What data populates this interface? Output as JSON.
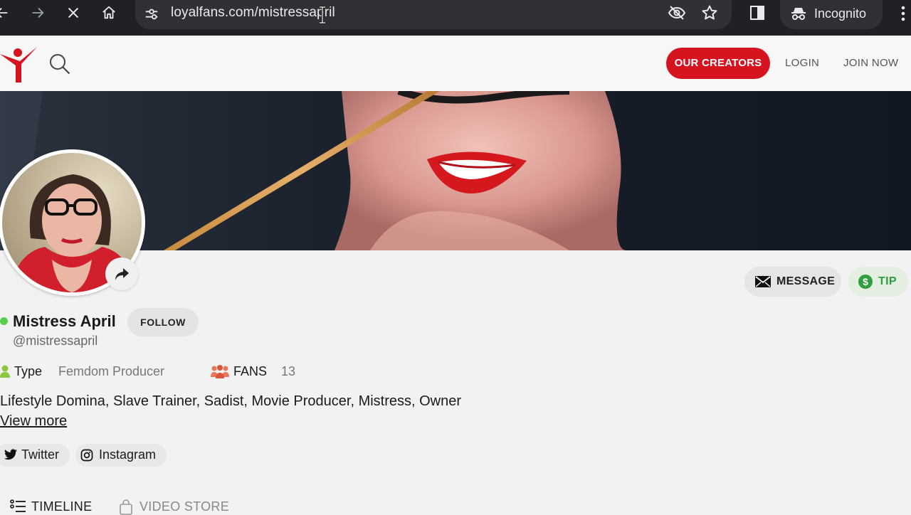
{
  "browser": {
    "url": "loyalfans.com/mistressapril",
    "incognito_label": "Incognito"
  },
  "header": {
    "creators_button": "OUR CREATORS",
    "login_button": "LOGIN",
    "join_button": "JOIN NOW",
    "brand_color": "#d6141f"
  },
  "profile": {
    "name": "Mistress April",
    "handle": "@mistressapril",
    "online": true,
    "follow_button": "FOLLOW",
    "message_button": "MESSAGE",
    "tip_button": "TIP",
    "type_label": "Type",
    "type_value": "Femdom Producer",
    "fans_label": "FANS",
    "fans_count": "13",
    "bio": "Lifestyle Domina, Slave Trainer, Sadist, Movie Producer, Mistress, Owner",
    "view_more": "View more",
    "social": [
      {
        "label": "Twitter",
        "icon": "twitter-icon"
      },
      {
        "label": "Instagram",
        "icon": "instagram-icon"
      }
    ]
  },
  "tabs": [
    {
      "label": "TIMELINE",
      "icon": "list-icon",
      "active": true
    },
    {
      "label": "VIDEO STORE",
      "icon": "bag-icon",
      "active": false
    }
  ]
}
